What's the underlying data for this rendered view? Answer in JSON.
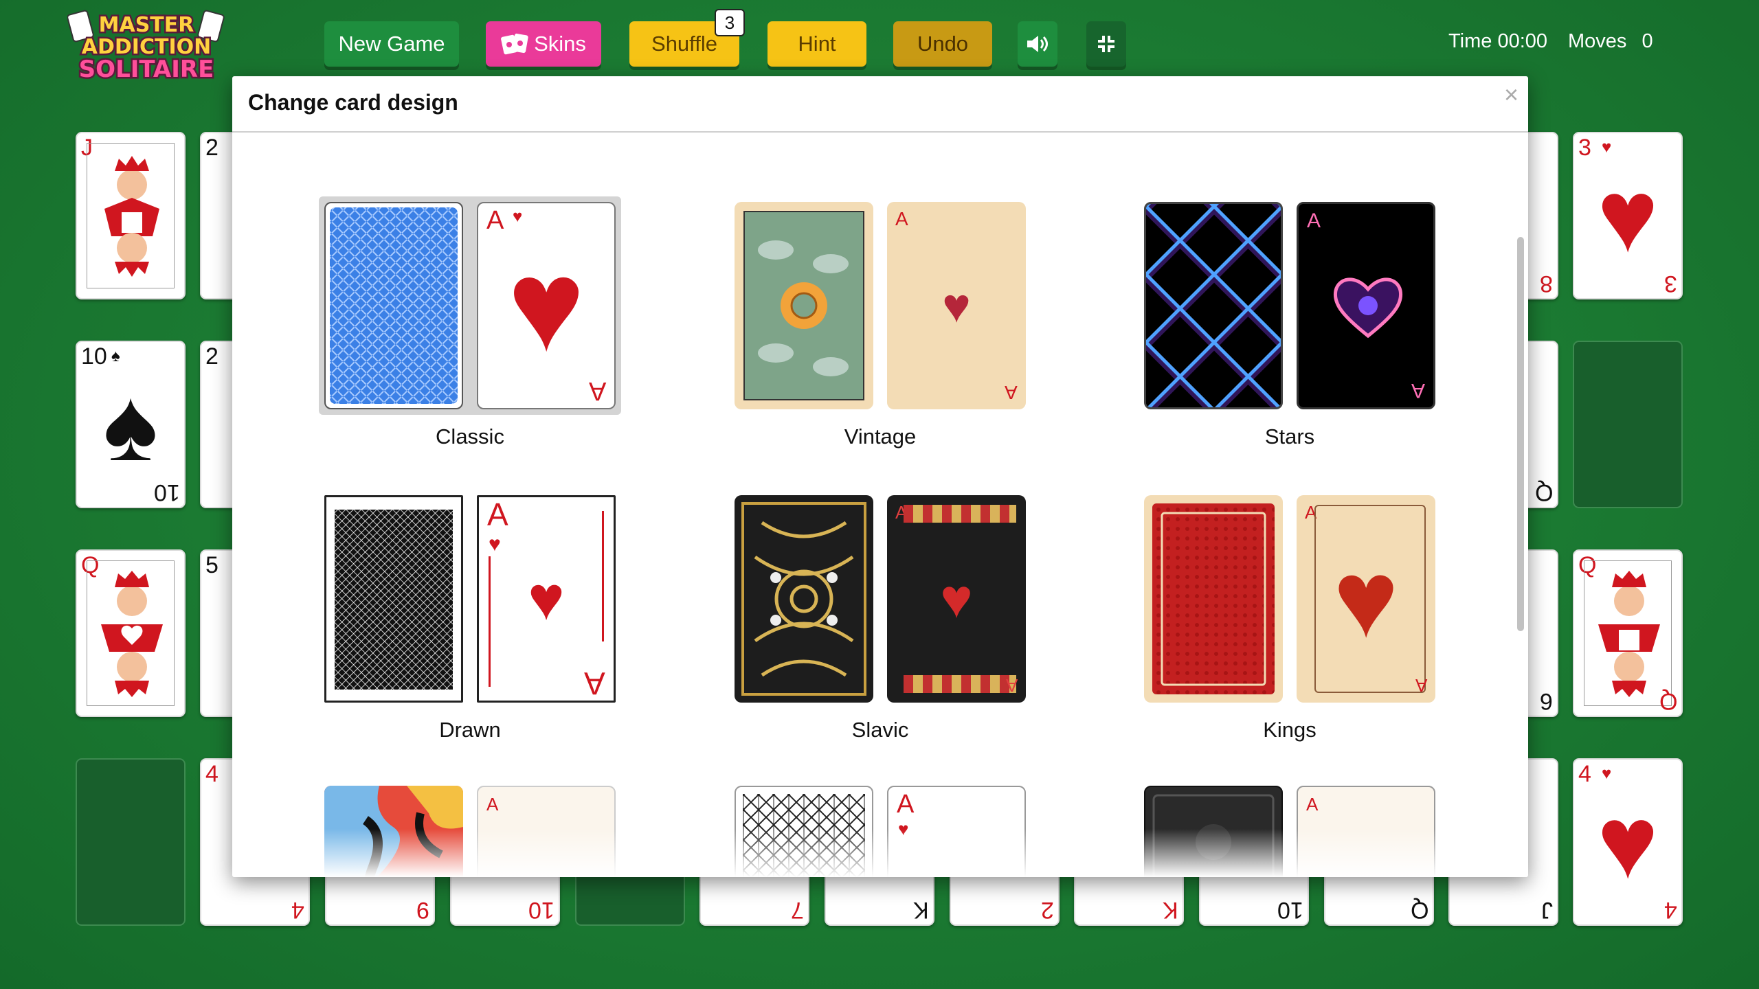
{
  "app": {
    "logo_line1": "MASTER",
    "logo_line2": "ADDICTION",
    "logo_line3": "SOLITAIRE"
  },
  "toolbar": {
    "new_game": "New Game",
    "skins": "Skins",
    "shuffle": "Shuffle",
    "shuffle_count": "3",
    "hint": "Hint",
    "undo": "Undo",
    "sound_icon": "speaker-icon",
    "fullscreen_icon": "exit-fullscreen-icon"
  },
  "stats": {
    "time_label": "Time",
    "time_value": "00:00",
    "moves_label": "Moves",
    "moves_value": "0"
  },
  "modal": {
    "title": "Change card design",
    "close": "×",
    "skins": [
      {
        "name": "Classic",
        "selected": true
      },
      {
        "name": "Vintage",
        "selected": false
      },
      {
        "name": "Stars",
        "selected": false
      },
      {
        "name": "Drawn",
        "selected": false
      },
      {
        "name": "Slavic",
        "selected": false
      },
      {
        "name": "Kings",
        "selected": false
      },
      {
        "name": "",
        "selected": false
      },
      {
        "name": "",
        "selected": false
      },
      {
        "name": "",
        "selected": false
      }
    ]
  },
  "board": {
    "left_column": [
      {
        "rank": "J",
        "suit": "♥",
        "color": "red"
      },
      {
        "rank": "10",
        "suit": "♠",
        "color": "black"
      },
      {
        "rank": "Q",
        "suit": "♥",
        "color": "red"
      }
    ],
    "second_column": [
      "2",
      "2",
      "5",
      "4"
    ],
    "right_column": [
      {
        "rank": "3",
        "suit": "♥",
        "color": "red"
      },
      {
        "rank": "Q",
        "suit": "♥",
        "color": "red"
      },
      {
        "rank": "4",
        "suit": "♥",
        "color": "red"
      }
    ],
    "peek_right": [
      "8",
      "Q",
      "6"
    ],
    "bottom_row": [
      "4",
      "9",
      "10",
      "7",
      "K",
      "2",
      "K",
      "10",
      "Q",
      "J"
    ]
  },
  "colors": {
    "felt": "#1b7a32",
    "new_game": "#1e8e3e",
    "skins": "#ea3a99",
    "shuffle": "#f6c315",
    "hint": "#f6c315",
    "undo": "#c89a14",
    "suit_red": "#d0161f"
  }
}
